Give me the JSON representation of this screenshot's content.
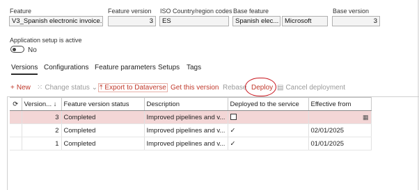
{
  "header": {
    "feature_label": "Feature",
    "feature_value": "V3_Spanish electronic invoice...",
    "feature_version_label": "Feature version",
    "feature_version_value": "3",
    "iso_label": "ISO Country/region codes",
    "iso_value": "ES",
    "base_feature_label": "Base feature",
    "base_feature_value": "Spanish elec...",
    "base_feature_provider": "Microsoft",
    "base_version_label": "Base version",
    "base_version_value": "3"
  },
  "setup": {
    "label": "Application setup is active",
    "toggle_state": "No"
  },
  "tabs": [
    "Versions",
    "Configurations",
    "Feature parameters",
    "Setups",
    "Tags"
  ],
  "toolbar": {
    "new": "New",
    "change_status": "Change status",
    "export": "Export to Dataverse",
    "get_version": "Get this version",
    "rebase": "Rebase",
    "deploy": "Deploy",
    "cancel_deployment": "Cancel deployment"
  },
  "grid": {
    "columns": [
      "Version...",
      "Feature version status",
      "Description",
      "Deployed to the service",
      "Effective from"
    ],
    "rows": [
      {
        "version": "3",
        "status": "Completed",
        "description": "Improved pipelines and v...",
        "deployed": false,
        "effective": ""
      },
      {
        "version": "2",
        "status": "Completed",
        "description": "Improved pipelines and v...",
        "deployed": true,
        "effective": "02/01/2025"
      },
      {
        "version": "1",
        "status": "Completed",
        "description": "Improved pipelines and v...",
        "deployed": true,
        "effective": "01/01/2025"
      }
    ]
  },
  "icons": {
    "refresh": "refresh-icon",
    "sort": "sort-down-icon",
    "calendar": "calendar-icon"
  }
}
